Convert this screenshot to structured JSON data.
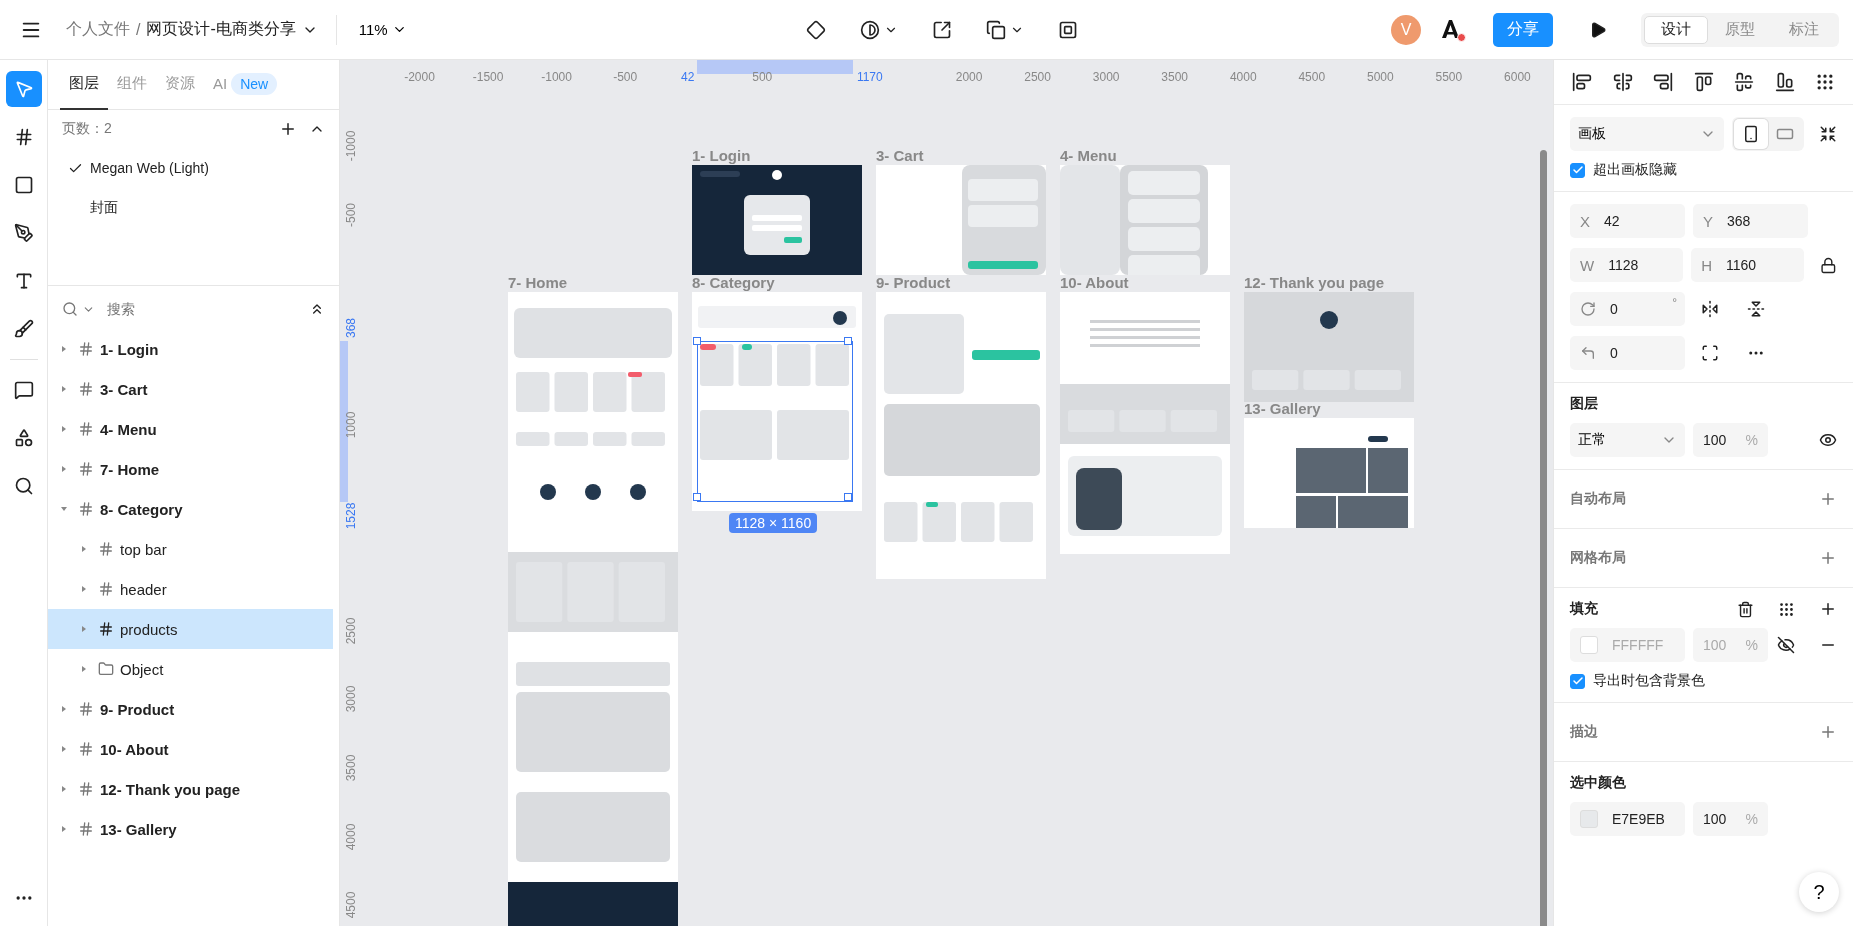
{
  "topbar": {
    "breadcrumb": {
      "parent": "个人文件",
      "separator": "/",
      "file": "网页设计-电商类分享"
    },
    "zoom": "11%",
    "avatar": "V",
    "share": "分享",
    "modes": [
      {
        "label": "设计",
        "selected": true
      },
      {
        "label": "原型",
        "selected": false
      },
      {
        "label": "标注",
        "selected": false
      }
    ]
  },
  "tools": [
    {
      "kind": "select",
      "selected": true
    },
    {
      "kind": "frame",
      "selected": false
    },
    {
      "kind": "rect",
      "selected": false
    },
    {
      "kind": "pen",
      "selected": false
    },
    {
      "kind": "text",
      "selected": false
    },
    {
      "kind": "pencil",
      "selected": false
    },
    {
      "kind": "divider"
    },
    {
      "kind": "comment",
      "selected": false
    },
    {
      "kind": "plugins",
      "selected": false
    },
    {
      "kind": "search",
      "selected": false
    }
  ],
  "left": {
    "tabs": [
      {
        "label": "图层",
        "selected": true
      },
      {
        "label": "组件",
        "selected": false
      },
      {
        "label": "资源",
        "selected": false
      },
      {
        "label": "AI",
        "selected": false,
        "badge": "New"
      }
    ],
    "pages_title": "页数：2",
    "pages": [
      {
        "name": "Megan Web (Light)",
        "selected": true
      },
      {
        "name": "封面",
        "selected": false
      }
    ],
    "search": {
      "placeholder": "搜索"
    },
    "layers": [
      {
        "name": "1- Login",
        "kind": "frame",
        "expanded": false,
        "selected": false
      },
      {
        "name": "3- Cart",
        "kind": "frame",
        "expanded": false,
        "selected": false
      },
      {
        "name": "4- Menu",
        "kind": "frame",
        "expanded": false,
        "selected": false
      },
      {
        "name": "7- Home",
        "kind": "frame",
        "expanded": false,
        "selected": false
      },
      {
        "name": "8- Category",
        "kind": "frame",
        "expanded": true,
        "selected": false,
        "children": [
          {
            "name": "top bar",
            "kind": "frame",
            "expanded": false,
            "selected": false
          },
          {
            "name": "header",
            "kind": "frame",
            "expanded": false,
            "selected": false
          },
          {
            "name": "products",
            "kind": "frame",
            "expanded": false,
            "selected": true
          },
          {
            "name": "Object",
            "kind": "group",
            "expanded": false,
            "selected": false
          }
        ]
      },
      {
        "name": "9- Product",
        "kind": "frame",
        "expanded": false,
        "selected": false
      },
      {
        "name": "10- About",
        "kind": "frame",
        "expanded": false,
        "selected": false
      },
      {
        "name": "12- Thank you page",
        "kind": "frame",
        "expanded": false,
        "selected": false
      },
      {
        "name": "13- Gallery",
        "kind": "frame",
        "expanded": false,
        "selected": false
      }
    ]
  },
  "canvas": {
    "ruler_x": [
      {
        "label": "-2000",
        "marked": false
      },
      {
        "label": "-1500",
        "marked": false
      },
      {
        "label": "-1000",
        "marked": false
      },
      {
        "label": "-500",
        "marked": false
      },
      {
        "label": "42",
        "marked": true
      },
      {
        "label": "500",
        "marked": false
      },
      {
        "label": "1170",
        "marked": true
      },
      {
        "label": "2000",
        "marked": false
      },
      {
        "label": "2500",
        "marked": false
      },
      {
        "label": "3000",
        "marked": false
      },
      {
        "label": "3500",
        "marked": false
      },
      {
        "label": "4000",
        "marked": false
      },
      {
        "label": "4500",
        "marked": false
      },
      {
        "label": "5000",
        "marked": false
      },
      {
        "label": "5500",
        "marked": false
      },
      {
        "label": "6000",
        "marked": false
      }
    ],
    "ruler_y": [
      {
        "label": "-1000",
        "marked": false
      },
      {
        "label": "-500",
        "marked": false
      },
      {
        "label": "368",
        "marked": true
      },
      {
        "label": "1000",
        "marked": false
      },
      {
        "label": "1528",
        "marked": true
      },
      {
        "label": "2500",
        "marked": false
      },
      {
        "label": "3000",
        "marked": false
      },
      {
        "label": "3500",
        "marked": false
      },
      {
        "label": "4000",
        "marked": false
      },
      {
        "label": "4500",
        "marked": false
      }
    ],
    "artboards": [
      {
        "label": "1- Login",
        "kind": "dark"
      },
      {
        "label": "3- Cart",
        "kind": "cart"
      },
      {
        "label": "4- Menu",
        "kind": "menu"
      },
      {
        "label": "7- Home",
        "kind": "long"
      },
      {
        "label": "8- Category",
        "kind": "grid"
      },
      {
        "label": "9- Product",
        "kind": "product"
      },
      {
        "label": "10- About",
        "kind": "about"
      },
      {
        "label": "12- Thank you page",
        "kind": "thanks"
      },
      {
        "label": "13- Gallery",
        "kind": "gallery"
      }
    ],
    "selection_size": "1128 × 1160"
  },
  "right": {
    "frame_preset": "画板",
    "orientation": [
      {
        "kind": "portrait",
        "selected": true
      },
      {
        "kind": "landscape",
        "selected": false
      }
    ],
    "clip": {
      "label": "超出画板隐藏",
      "checked": true
    },
    "fields": [
      {
        "key": "X",
        "value": "42"
      },
      {
        "key": "Y",
        "value": "368"
      },
      {
        "key": "W",
        "value": "1128"
      },
      {
        "key": "H",
        "value": "1160"
      }
    ],
    "rotation": "0",
    "degree": "°",
    "radius": "0",
    "layer": {
      "title": "图层",
      "blend": "正常",
      "opacity": "100",
      "unit": "%"
    },
    "auto_layout": "自动布局",
    "grid_layout": "网格布局",
    "fill": {
      "title": "填充",
      "hex": "FFFFFF",
      "opacity": "100",
      "unit": "%",
      "visible": false,
      "color": "#ffffff"
    },
    "export_bg": {
      "label": "导出时包含背景色",
      "checked": true
    },
    "stroke": "描边",
    "selected_colors": {
      "title": "选中颜色",
      "hex": "E7E9EB",
      "opacity": "100",
      "unit": "%",
      "color": "#e7e9eb"
    },
    "help": "?"
  }
}
